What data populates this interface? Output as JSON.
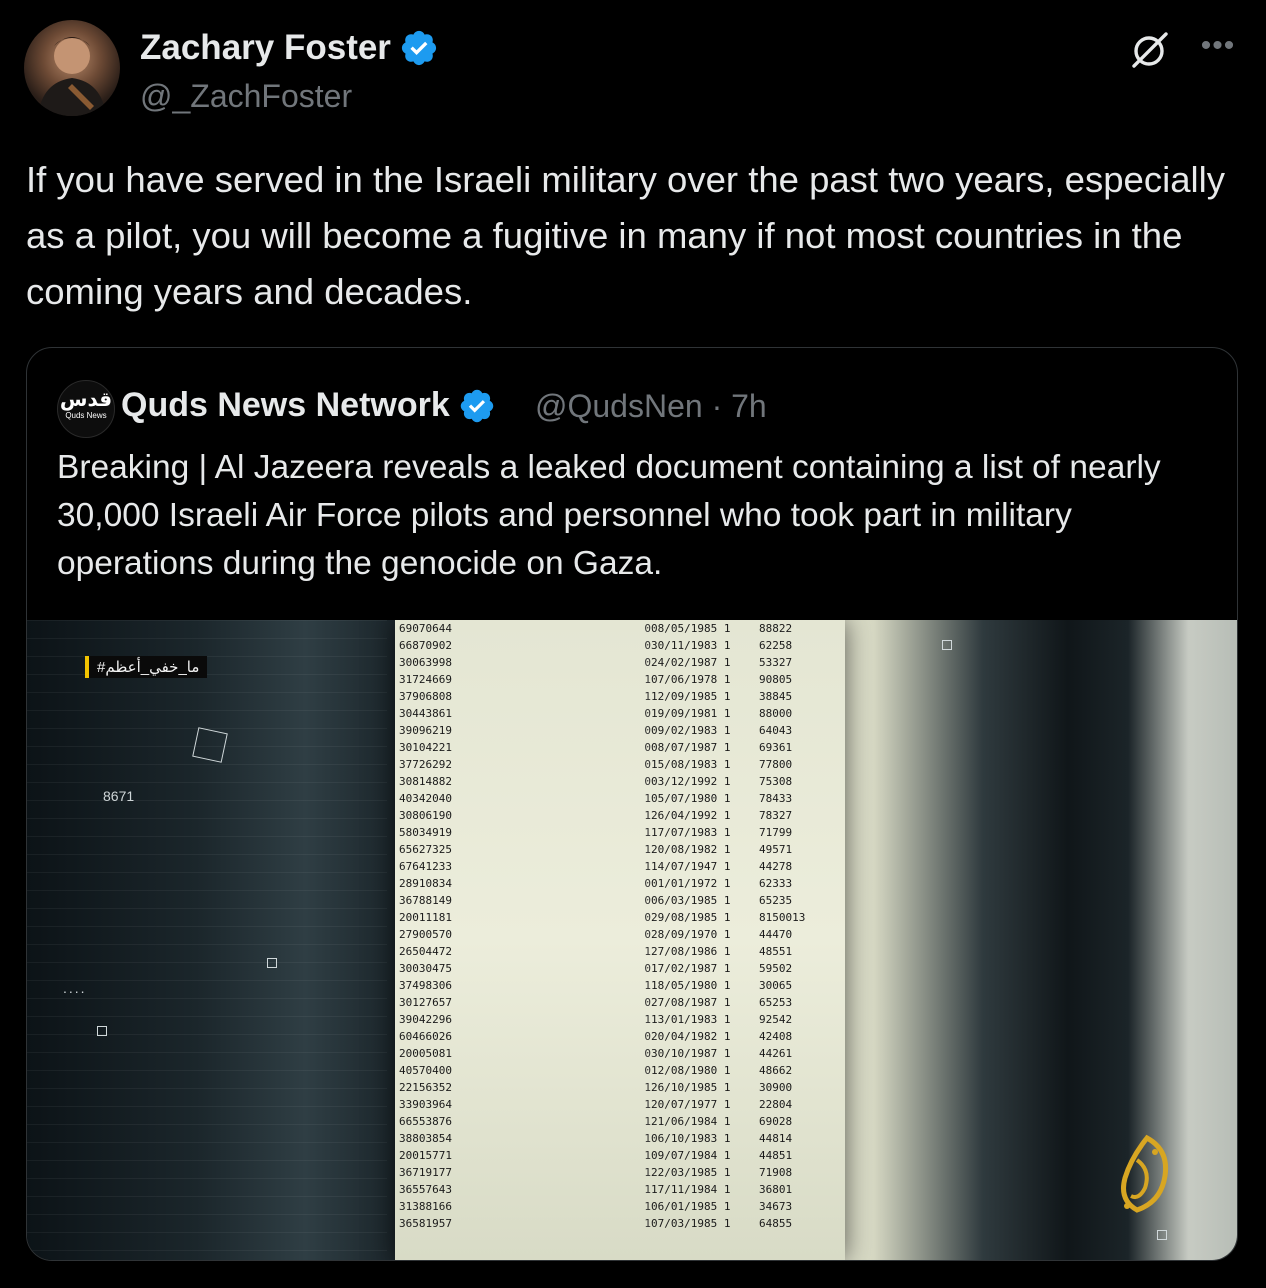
{
  "author": {
    "name": "Zachary Foster",
    "handle": "@_ZachFoster",
    "verified": true
  },
  "tweet": {
    "text": "If you have served in the Israeli military over the past two years, especially as a pilot, you will become a fugitive in many if not most countries in the coming years and decades."
  },
  "icons": {
    "grok": "grok-icon",
    "more": "more-icon",
    "verified": "verified-badge-icon"
  },
  "quote": {
    "name": "Quds News Network",
    "handle": "@QudsNen",
    "separator": "·",
    "time": "7h",
    "verified": true,
    "avatar_text_ar": "قدس",
    "avatar_text_en": "Quds News",
    "text": "Breaking | Al Jazeera reveals a leaked document containing a list of nearly 30,000 Israeli Air Force pilots and personnel who took part in military operations during the genocide on Gaza."
  },
  "media": {
    "hashtag": "#ما_خفي_أعظم",
    "side_number": "8671",
    "rows": [
      [
        "69070644",
        "0",
        "08/05/1985 1",
        "88822"
      ],
      [
        "66870902",
        "0",
        "30/11/1983 1",
        "62258"
      ],
      [
        "30063998",
        "0",
        "24/02/1987 1",
        "53327"
      ],
      [
        "31724669",
        "1",
        "07/06/1978 1",
        "90805"
      ],
      [
        "37906808",
        "1",
        "12/09/1985 1",
        "38845"
      ],
      [
        "30443861",
        "0",
        "19/09/1981 1",
        "88000"
      ],
      [
        "39096219",
        "0",
        "09/02/1983 1",
        "64043"
      ],
      [
        "30104221",
        "0",
        "08/07/1987 1",
        "69361"
      ],
      [
        "37726292",
        "0",
        "15/08/1983 1",
        "77800"
      ],
      [
        "30814882",
        "0",
        "03/12/1992 1",
        "75308"
      ],
      [
        "40342040",
        "1",
        "05/07/1980 1",
        "78433"
      ],
      [
        "30806190",
        "1",
        "26/04/1992 1",
        "78327"
      ],
      [
        "58034919",
        "1",
        "17/07/1983 1",
        "71799"
      ],
      [
        "65627325",
        "1",
        "20/08/1982 1",
        "49571"
      ],
      [
        "67641233",
        "1",
        "14/07/1947 1",
        "44278"
      ],
      [
        "28910834",
        "0",
        "01/01/1972 1",
        "62333"
      ],
      [
        "36788149",
        "0",
        "06/03/1985 1",
        "65235"
      ],
      [
        "20011181",
        "0",
        "29/08/1985 1",
        "8150013"
      ],
      [
        "27900570",
        "0",
        "28/09/1970 1",
        "44470"
      ],
      [
        "26504472",
        "1",
        "27/08/1986 1",
        "48551"
      ],
      [
        "30030475",
        "0",
        "17/02/1987 1",
        "59502"
      ],
      [
        "37498306",
        "1",
        "18/05/1980 1",
        "30065"
      ],
      [
        "30127657",
        "0",
        "27/08/1987 1",
        "65253"
      ],
      [
        "39042296",
        "1",
        "13/01/1983 1",
        "92542"
      ],
      [
        "60466026",
        "0",
        "20/04/1982 1",
        "42408"
      ],
      [
        "20005081",
        "0",
        "30/10/1987 1",
        "44261"
      ],
      [
        "40570400",
        "0",
        "12/08/1980 1",
        "48662"
      ],
      [
        "22156352",
        "1",
        "26/10/1985 1",
        "30900"
      ],
      [
        "33903964",
        "1",
        "20/07/1977 1",
        "22804"
      ],
      [
        "66553876",
        "1",
        "21/06/1984 1",
        "69028"
      ],
      [
        "38803854",
        "1",
        "06/10/1983 1",
        "44814"
      ],
      [
        "20015771",
        "1",
        "09/07/1984 1",
        "44851"
      ],
      [
        "36719177",
        "1",
        "22/03/1985 1",
        "71908"
      ],
      [
        "36557643",
        "1",
        "17/11/1984 1",
        "36801"
      ],
      [
        "31388166",
        "1",
        "06/01/1985 1",
        "34673"
      ],
      [
        "36581957",
        "1",
        "07/03/1985 1",
        "64855"
      ]
    ]
  },
  "colors": {
    "background": "#000000",
    "text_primary": "#e7e9ea",
    "text_secondary": "#71767b",
    "verified_blue": "#1d9bf0",
    "border": "#2f3336"
  }
}
